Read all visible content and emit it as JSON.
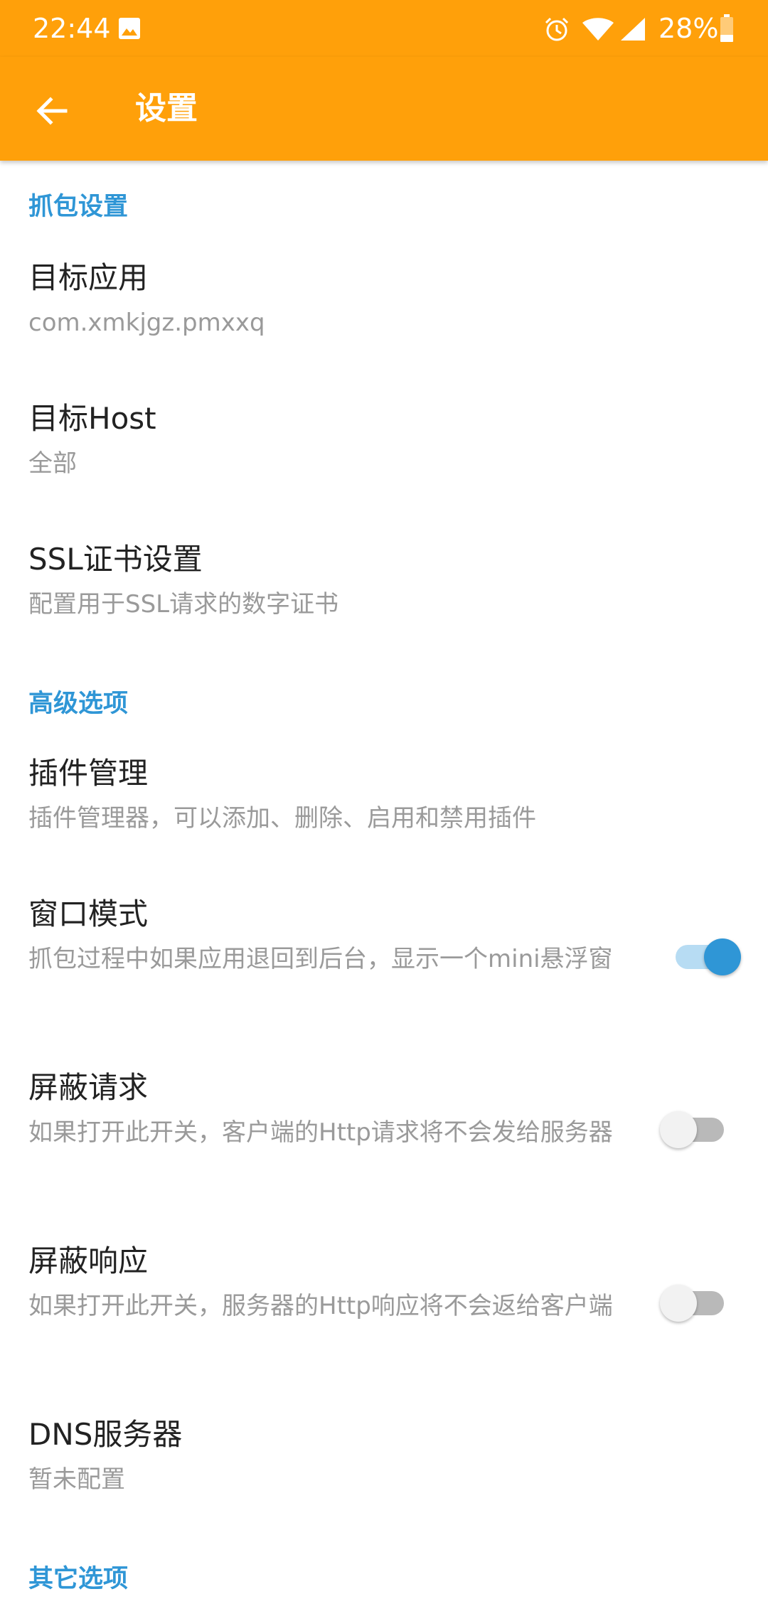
{
  "status_bar": {
    "time": "22:44",
    "battery_text": "28%",
    "icons": [
      "image-icon",
      "alarm-icon",
      "wifi-icon",
      "cell-signal-icon",
      "battery-icon"
    ]
  },
  "app_bar": {
    "title": "设置",
    "back_icon": "arrow-back-icon",
    "background": "#ffa00a"
  },
  "colors": {
    "accent": "#2f96d6",
    "title_text": "#222222",
    "summary_text": "#9a9a9a"
  },
  "sections": [
    {
      "header": "抓包设置",
      "items": [
        {
          "title": "目标应用",
          "summary": "com.xmkjgz.pmxxq"
        },
        {
          "title": "目标Host",
          "summary": "全部"
        },
        {
          "title": "SSL证书设置",
          "summary": "配置用于SSL请求的数字证书"
        }
      ]
    },
    {
      "header": "高级选项",
      "items": [
        {
          "title": "插件管理",
          "summary": "插件管理器，可以添加、删除、启用和禁用插件"
        },
        {
          "title": "窗口模式",
          "summary": "抓包过程中如果应用退回到后台，显示一个mini悬浮窗",
          "switch": true
        },
        {
          "title": "屏蔽请求",
          "summary": "如果打开此开关，客户端的Http请求将不会发给服务器",
          "switch": false
        },
        {
          "title": "屏蔽响应",
          "summary": "如果打开此开关，服务器的Http响应将不会返给客户端",
          "switch": false
        },
        {
          "title": "DNS服务器",
          "summary": "暂未配置"
        }
      ]
    },
    {
      "header": "其它选项",
      "items": []
    }
  ]
}
